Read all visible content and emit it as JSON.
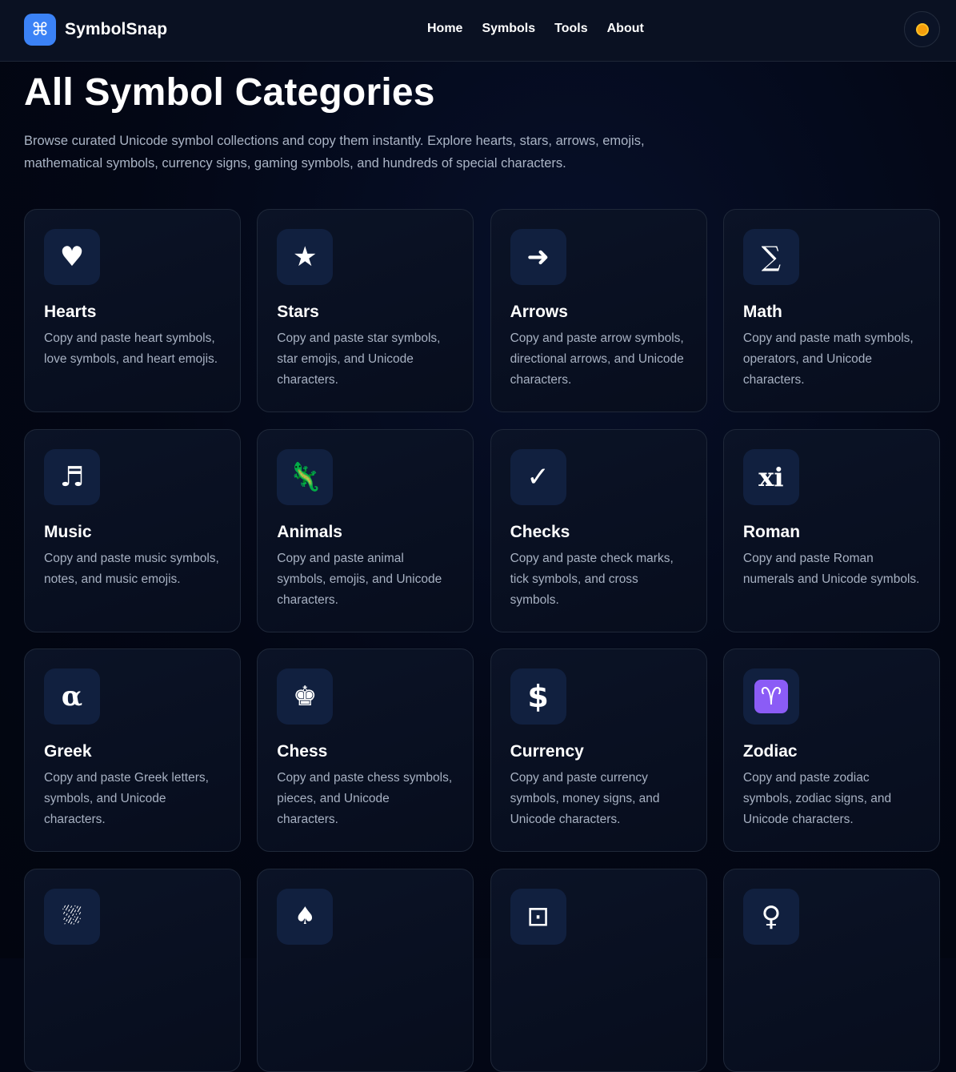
{
  "brand": {
    "logo_glyph": "⌘",
    "name": "SymbolSnap",
    "accent_color": "#3b82f6"
  },
  "nav": {
    "items": [
      "Home",
      "Symbols",
      "Tools",
      "About"
    ]
  },
  "theme_toggle": {
    "icon": "sun-icon"
  },
  "main": {
    "title": "All Symbol Categories",
    "intro": "Browse curated Unicode symbol collections and copy them instantly. Explore hearts, stars, arrows, emojis, mathematical symbols, currency signs, gaming symbols, and hundreds of special characters."
  },
  "categories": [
    {
      "glyph": "♥",
      "icon": "heart-icon",
      "title": "Hearts",
      "desc": "Copy and paste heart symbols, love symbols, and heart emojis."
    },
    {
      "glyph": "★",
      "icon": "star-icon",
      "title": "Stars",
      "desc": "Copy and paste star symbols, star emojis, and Unicode characters."
    },
    {
      "glyph": "➜",
      "icon": "arrow-icon",
      "title": "Arrows",
      "desc": "Copy and paste arrow symbols, directional arrows, and Unicode characters."
    },
    {
      "glyph": "∑",
      "icon": "sigma-icon",
      "title": "Math",
      "desc": "Copy and paste math symbols, operators, and Unicode characters."
    },
    {
      "glyph": "♬",
      "icon": "music-note-icon",
      "title": "Music",
      "desc": "Copy and paste music symbols, notes, and music emojis."
    },
    {
      "glyph": "🦎",
      "icon": "lizard-icon",
      "title": "Animals",
      "desc": "Copy and paste animal symbols, emojis, and Unicode characters."
    },
    {
      "glyph": "✓",
      "icon": "check-icon",
      "title": "Checks",
      "desc": "Copy and paste check marks, tick symbols, and cross symbols."
    },
    {
      "glyph": "xi",
      "icon": "roman-numeral-icon",
      "title": "Roman",
      "desc": "Copy and paste Roman numerals and Unicode symbols."
    },
    {
      "glyph": "α",
      "icon": "alpha-icon",
      "title": "Greek",
      "desc": "Copy and paste Greek letters, symbols, and Unicode characters."
    },
    {
      "glyph": "♚",
      "icon": "chess-king-icon",
      "title": "Chess",
      "desc": "Copy and paste chess symbols, pieces, and Unicode characters."
    },
    {
      "glyph": "$",
      "icon": "dollar-icon",
      "title": "Currency",
      "desc": "Copy and paste currency symbols, money signs, and Unicode characters."
    },
    {
      "glyph": "♈",
      "icon": "aries-icon",
      "title": "Zodiac",
      "desc": "Copy and paste zodiac symbols, zodiac signs, and Unicode characters."
    },
    {
      "glyph": "⛆",
      "icon": "rain-cloud-icon",
      "title": "",
      "desc": ""
    },
    {
      "glyph": "♠",
      "icon": "spade-icon",
      "title": "",
      "desc": ""
    },
    {
      "glyph": "⊡",
      "icon": "squared-dot-icon",
      "title": "",
      "desc": ""
    },
    {
      "glyph": "♀",
      "icon": "female-sign-icon",
      "title": "",
      "desc": ""
    }
  ]
}
